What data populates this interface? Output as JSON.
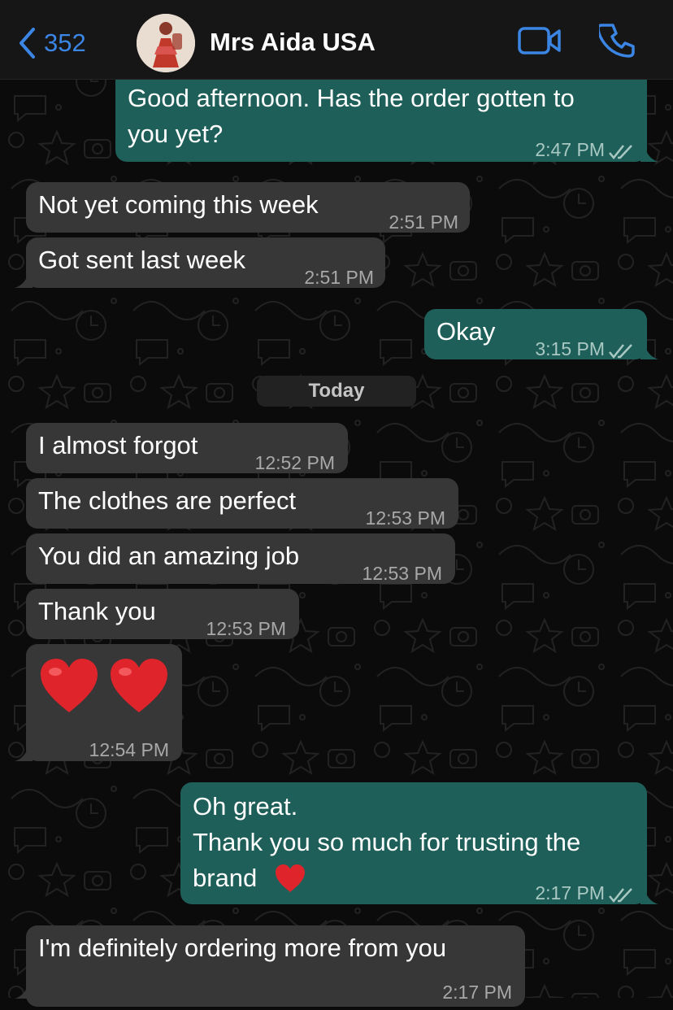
{
  "header": {
    "back_count": "352",
    "contact_name": "Mrs Aida USA",
    "accent_color": "#3b86e4",
    "icons": [
      "chevron-left-icon",
      "video-call-icon",
      "phone-icon"
    ]
  },
  "messages": [
    {
      "direction": "out",
      "text": "Good afternoon. Has the order gotten to\nyou yet?",
      "time": "2:47 PM",
      "read": true
    },
    {
      "direction": "in",
      "text": "Not yet coming this week",
      "time": "2:51 PM"
    },
    {
      "direction": "in",
      "text": "Got sent last week",
      "time": "2:51 PM"
    },
    {
      "direction": "out",
      "text": "Okay",
      "time": "3:15 PM",
      "read": true
    },
    {
      "direction": "in",
      "text": "I almost forgot",
      "time": "12:52 PM"
    },
    {
      "direction": "in",
      "text": "The clothes are perfect",
      "time": "12:53 PM"
    },
    {
      "direction": "in",
      "text": "You did an amazing job",
      "time": "12:53 PM"
    },
    {
      "direction": "in",
      "text": "Thank you",
      "time": "12:53 PM"
    },
    {
      "direction": "in",
      "emoji": [
        "red-heart",
        "red-heart"
      ],
      "time": "12:54 PM"
    },
    {
      "direction": "out",
      "text": "Oh great.\nThank you so much for trusting the\nbrand",
      "emoji": "red-heart",
      "time": "2:17 PM",
      "read": true
    },
    {
      "direction": "in",
      "text": "I'm definitely ordering more from you",
      "time": "2:17 PM"
    }
  ],
  "day_separator": "Today",
  "colors": {
    "incoming_bubble": "#373737",
    "outgoing_bubble": "#1f5f59",
    "background": "#0b0b0b"
  }
}
